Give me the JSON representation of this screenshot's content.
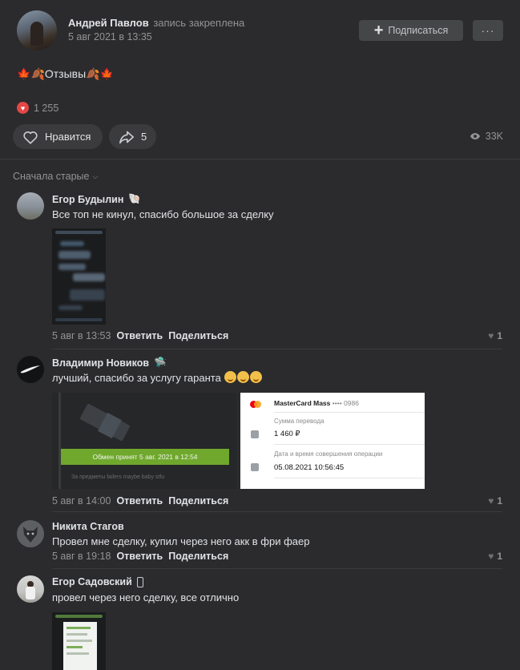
{
  "post": {
    "author_name": "Андрей Павлов",
    "pinned_label": "запись закреплена",
    "date": "5 авг 2021 в 13:35",
    "subscribe_label": "Подписаться",
    "more_label": "···",
    "text": "Отзывы",
    "reaction_count": "1 255",
    "like_label": "Нравится",
    "share_count": "5",
    "views": "33K"
  },
  "sort_label": "Сначала старые",
  "comments": [
    {
      "name": "Егор Будылин",
      "text": "Все топ не кинул, спасибо большое за сделку",
      "date": "5 авг в 13:53",
      "reply": "Ответить",
      "share": "Поделиться",
      "likes": "1"
    },
    {
      "name": "Владимир Новиков",
      "text": "лучший, спасибо за услугу гаранта",
      "date": "5 авг в 14:00",
      "reply": "Ответить",
      "share": "Поделиться",
      "likes": "1",
      "trade_banner": "Обмен принят 5 авг. 2021 в 12:54",
      "trade_footer": "За предметы failers maybe baby stfu",
      "card_title": "MasterCard Mass",
      "card_number": "•••• 0986",
      "amount_label": "Сумма перевода",
      "amount_value": "1 460 ₽",
      "datetime_label": "Дата и время совершения операции",
      "datetime_value": "05.08.2021 10:56:45"
    },
    {
      "name": "Никита Стагов",
      "text": "Провел мне сделку, купил через него акк в фри фаер",
      "date": "5 авг в 19:18",
      "reply": "Ответить",
      "share": "Поделиться",
      "likes": "1"
    },
    {
      "name": "Егор Садовский",
      "text": "провел через него сделку, все отлично"
    }
  ],
  "colors": {
    "background": "#2b2b2d",
    "button_bg": "#3b3b3d",
    "accent_red": "#e64646",
    "trade_green": "#6fa82d"
  }
}
